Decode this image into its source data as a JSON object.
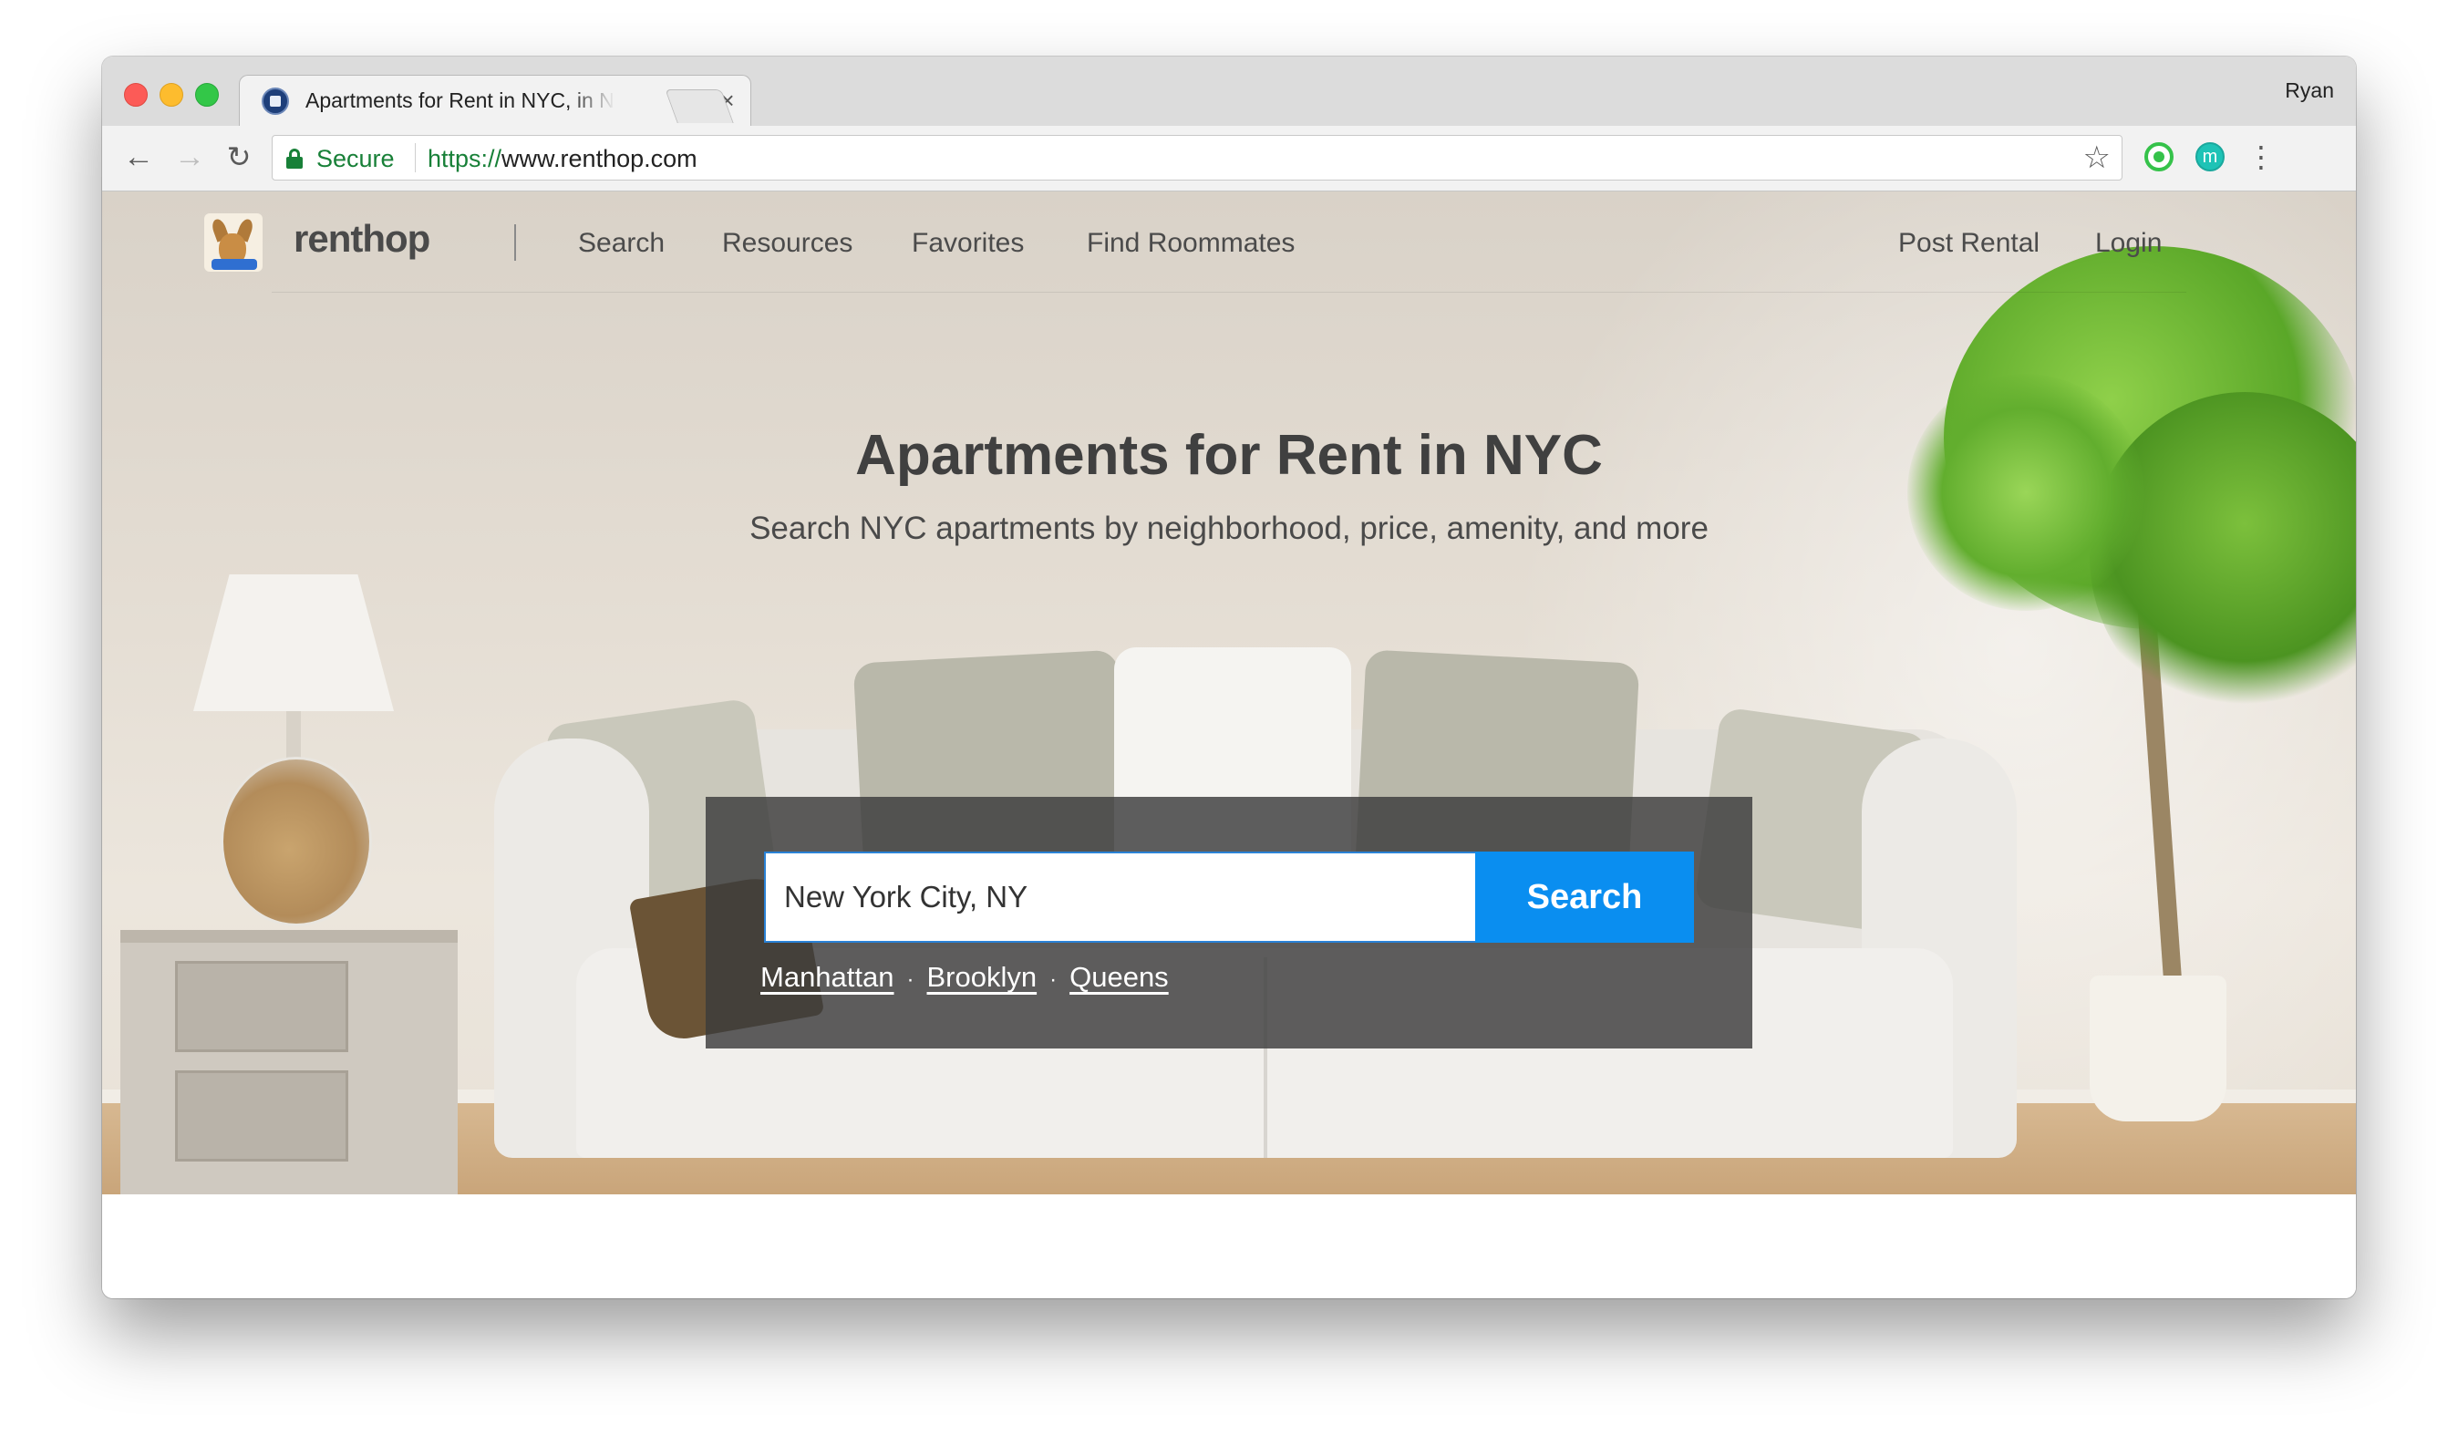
{
  "browser": {
    "tab_title": "Apartments for Rent in NYC, in New York City",
    "tab_close": "×",
    "profile_name": "Ryan",
    "secure_label": "Secure",
    "url_scheme": "https://",
    "url_host": "www.renthop.com",
    "icons": {
      "back": "←",
      "forward": "→",
      "reload": "↻",
      "bookmark": "☆",
      "menu": "⋮",
      "extension_teal_letter": "m"
    }
  },
  "site": {
    "logo_text": "renthop",
    "nav_left": [
      "Search",
      "Resources",
      "Favorites",
      "Find Roommates"
    ],
    "nav_right": [
      "Post Rental",
      "Login"
    ]
  },
  "hero": {
    "title": "Apartments for Rent in NYC",
    "subtitle": "Search NYC apartments by neighborhood, price, amenity, and more"
  },
  "search": {
    "input_value": "New York City, NY",
    "button_label": "Search",
    "quick_links": [
      "Manhattan",
      "Brooklyn",
      "Queens"
    ],
    "separator": "·"
  },
  "colors": {
    "accent": "#0a8ef0",
    "secure_green": "#188038",
    "panel_overlay": "#3c3c3c"
  }
}
